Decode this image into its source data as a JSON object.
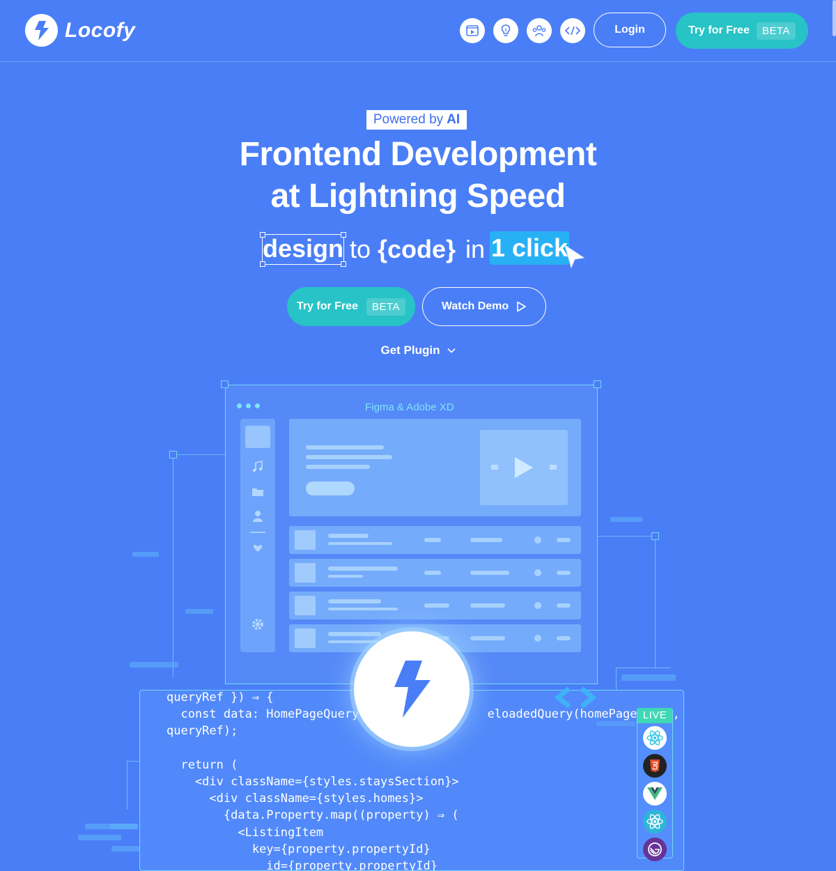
{
  "brand": {
    "name": "Locofy"
  },
  "nav": {
    "icons": [
      "video-icon",
      "lightbulb-icon",
      "community-icon",
      "code-icon"
    ],
    "login_label": "Login",
    "try_label": "Try for Free",
    "beta_label": "BETA"
  },
  "hero": {
    "powered_prefix": "Powered by",
    "powered_ai": "AI",
    "headline_line1": "Frontend Development",
    "headline_line2": "at Lightning Speed",
    "tag_design": "design",
    "tag_to": "to",
    "tag_code": "{code}",
    "tag_in": "in",
    "tag_click": "1 click",
    "cta_try_label": "Try for Free",
    "cta_beta_label": "BETA",
    "cta_demo_label": "Watch Demo",
    "plugin_label": "Get Plugin"
  },
  "illustration": {
    "window_title": "Figma & Adobe XD",
    "live_label": "LIVE",
    "frameworks": [
      "react-icon",
      "html5-icon",
      "vue-icon",
      "react-native-icon",
      "gatsby-icon"
    ],
    "code": "queryRef }) ⇒ {\n  const data: HomePageQuery                  eloadedQuery(homePageQuery,\nqueryRef);\n\n  return (\n    <div className={styles.staysSection}>\n      <div className={styles.homes}>\n        {data.Property.map((property) ⇒ (\n          <ListingItem\n            key={property.propertyId}\n              id={property.propertyId}"
  },
  "colors": {
    "background": "#4a7ef6",
    "accent_teal": "#27c3c6",
    "highlight_blue": "#28b0f5",
    "live_green": "#3ed8b4",
    "outline_cyan": "#74d6f5"
  }
}
